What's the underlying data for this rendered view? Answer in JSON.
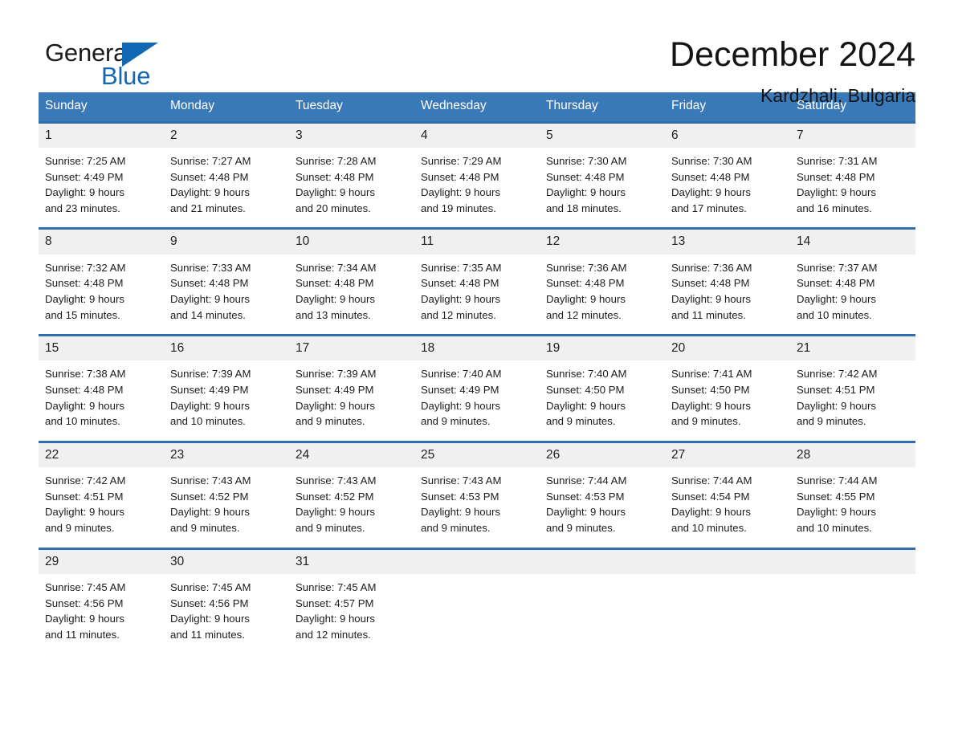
{
  "brand": {
    "word1": "General",
    "word2": "Blue",
    "accent_color": "#1268b3",
    "triangle_icon": "triangle-logo-icon"
  },
  "header": {
    "title": "December 2024",
    "subtitle": "Kardzhali, Bulgaria"
  },
  "calendar": {
    "header_bg": "#3a79b8",
    "row_divider": "#2f6fae",
    "daynum_bg": "#f0f0f0",
    "weekdays": [
      "Sunday",
      "Monday",
      "Tuesday",
      "Wednesday",
      "Thursday",
      "Friday",
      "Saturday"
    ],
    "weeks": [
      {
        "days": [
          {
            "num": "1",
            "sunrise": "Sunrise: 7:25 AM",
            "sunset": "Sunset: 4:49 PM",
            "daylight1": "Daylight: 9 hours",
            "daylight2": "and 23 minutes."
          },
          {
            "num": "2",
            "sunrise": "Sunrise: 7:27 AM",
            "sunset": "Sunset: 4:48 PM",
            "daylight1": "Daylight: 9 hours",
            "daylight2": "and 21 minutes."
          },
          {
            "num": "3",
            "sunrise": "Sunrise: 7:28 AM",
            "sunset": "Sunset: 4:48 PM",
            "daylight1": "Daylight: 9 hours",
            "daylight2": "and 20 minutes."
          },
          {
            "num": "4",
            "sunrise": "Sunrise: 7:29 AM",
            "sunset": "Sunset: 4:48 PM",
            "daylight1": "Daylight: 9 hours",
            "daylight2": "and 19 minutes."
          },
          {
            "num": "5",
            "sunrise": "Sunrise: 7:30 AM",
            "sunset": "Sunset: 4:48 PM",
            "daylight1": "Daylight: 9 hours",
            "daylight2": "and 18 minutes."
          },
          {
            "num": "6",
            "sunrise": "Sunrise: 7:30 AM",
            "sunset": "Sunset: 4:48 PM",
            "daylight1": "Daylight: 9 hours",
            "daylight2": "and 17 minutes."
          },
          {
            "num": "7",
            "sunrise": "Sunrise: 7:31 AM",
            "sunset": "Sunset: 4:48 PM",
            "daylight1": "Daylight: 9 hours",
            "daylight2": "and 16 minutes."
          }
        ]
      },
      {
        "days": [
          {
            "num": "8",
            "sunrise": "Sunrise: 7:32 AM",
            "sunset": "Sunset: 4:48 PM",
            "daylight1": "Daylight: 9 hours",
            "daylight2": "and 15 minutes."
          },
          {
            "num": "9",
            "sunrise": "Sunrise: 7:33 AM",
            "sunset": "Sunset: 4:48 PM",
            "daylight1": "Daylight: 9 hours",
            "daylight2": "and 14 minutes."
          },
          {
            "num": "10",
            "sunrise": "Sunrise: 7:34 AM",
            "sunset": "Sunset: 4:48 PM",
            "daylight1": "Daylight: 9 hours",
            "daylight2": "and 13 minutes."
          },
          {
            "num": "11",
            "sunrise": "Sunrise: 7:35 AM",
            "sunset": "Sunset: 4:48 PM",
            "daylight1": "Daylight: 9 hours",
            "daylight2": "and 12 minutes."
          },
          {
            "num": "12",
            "sunrise": "Sunrise: 7:36 AM",
            "sunset": "Sunset: 4:48 PM",
            "daylight1": "Daylight: 9 hours",
            "daylight2": "and 12 minutes."
          },
          {
            "num": "13",
            "sunrise": "Sunrise: 7:36 AM",
            "sunset": "Sunset: 4:48 PM",
            "daylight1": "Daylight: 9 hours",
            "daylight2": "and 11 minutes."
          },
          {
            "num": "14",
            "sunrise": "Sunrise: 7:37 AM",
            "sunset": "Sunset: 4:48 PM",
            "daylight1": "Daylight: 9 hours",
            "daylight2": "and 10 minutes."
          }
        ]
      },
      {
        "days": [
          {
            "num": "15",
            "sunrise": "Sunrise: 7:38 AM",
            "sunset": "Sunset: 4:48 PM",
            "daylight1": "Daylight: 9 hours",
            "daylight2": "and 10 minutes."
          },
          {
            "num": "16",
            "sunrise": "Sunrise: 7:39 AM",
            "sunset": "Sunset: 4:49 PM",
            "daylight1": "Daylight: 9 hours",
            "daylight2": "and 10 minutes."
          },
          {
            "num": "17",
            "sunrise": "Sunrise: 7:39 AM",
            "sunset": "Sunset: 4:49 PM",
            "daylight1": "Daylight: 9 hours",
            "daylight2": "and 9 minutes."
          },
          {
            "num": "18",
            "sunrise": "Sunrise: 7:40 AM",
            "sunset": "Sunset: 4:49 PM",
            "daylight1": "Daylight: 9 hours",
            "daylight2": "and 9 minutes."
          },
          {
            "num": "19",
            "sunrise": "Sunrise: 7:40 AM",
            "sunset": "Sunset: 4:50 PM",
            "daylight1": "Daylight: 9 hours",
            "daylight2": "and 9 minutes."
          },
          {
            "num": "20",
            "sunrise": "Sunrise: 7:41 AM",
            "sunset": "Sunset: 4:50 PM",
            "daylight1": "Daylight: 9 hours",
            "daylight2": "and 9 minutes."
          },
          {
            "num": "21",
            "sunrise": "Sunrise: 7:42 AM",
            "sunset": "Sunset: 4:51 PM",
            "daylight1": "Daylight: 9 hours",
            "daylight2": "and 9 minutes."
          }
        ]
      },
      {
        "days": [
          {
            "num": "22",
            "sunrise": "Sunrise: 7:42 AM",
            "sunset": "Sunset: 4:51 PM",
            "daylight1": "Daylight: 9 hours",
            "daylight2": "and 9 minutes."
          },
          {
            "num": "23",
            "sunrise": "Sunrise: 7:43 AM",
            "sunset": "Sunset: 4:52 PM",
            "daylight1": "Daylight: 9 hours",
            "daylight2": "and 9 minutes."
          },
          {
            "num": "24",
            "sunrise": "Sunrise: 7:43 AM",
            "sunset": "Sunset: 4:52 PM",
            "daylight1": "Daylight: 9 hours",
            "daylight2": "and 9 minutes."
          },
          {
            "num": "25",
            "sunrise": "Sunrise: 7:43 AM",
            "sunset": "Sunset: 4:53 PM",
            "daylight1": "Daylight: 9 hours",
            "daylight2": "and 9 minutes."
          },
          {
            "num": "26",
            "sunrise": "Sunrise: 7:44 AM",
            "sunset": "Sunset: 4:53 PM",
            "daylight1": "Daylight: 9 hours",
            "daylight2": "and 9 minutes."
          },
          {
            "num": "27",
            "sunrise": "Sunrise: 7:44 AM",
            "sunset": "Sunset: 4:54 PM",
            "daylight1": "Daylight: 9 hours",
            "daylight2": "and 10 minutes."
          },
          {
            "num": "28",
            "sunrise": "Sunrise: 7:44 AM",
            "sunset": "Sunset: 4:55 PM",
            "daylight1": "Daylight: 9 hours",
            "daylight2": "and 10 minutes."
          }
        ]
      },
      {
        "days": [
          {
            "num": "29",
            "sunrise": "Sunrise: 7:45 AM",
            "sunset": "Sunset: 4:56 PM",
            "daylight1": "Daylight: 9 hours",
            "daylight2": "and 11 minutes."
          },
          {
            "num": "30",
            "sunrise": "Sunrise: 7:45 AM",
            "sunset": "Sunset: 4:56 PM",
            "daylight1": "Daylight: 9 hours",
            "daylight2": "and 11 minutes."
          },
          {
            "num": "31",
            "sunrise": "Sunrise: 7:45 AM",
            "sunset": "Sunset: 4:57 PM",
            "daylight1": "Daylight: 9 hours",
            "daylight2": "and 12 minutes."
          },
          {
            "num": "",
            "sunrise": "",
            "sunset": "",
            "daylight1": "",
            "daylight2": ""
          },
          {
            "num": "",
            "sunrise": "",
            "sunset": "",
            "daylight1": "",
            "daylight2": ""
          },
          {
            "num": "",
            "sunrise": "",
            "sunset": "",
            "daylight1": "",
            "daylight2": ""
          },
          {
            "num": "",
            "sunrise": "",
            "sunset": "",
            "daylight1": "",
            "daylight2": ""
          }
        ]
      }
    ]
  }
}
